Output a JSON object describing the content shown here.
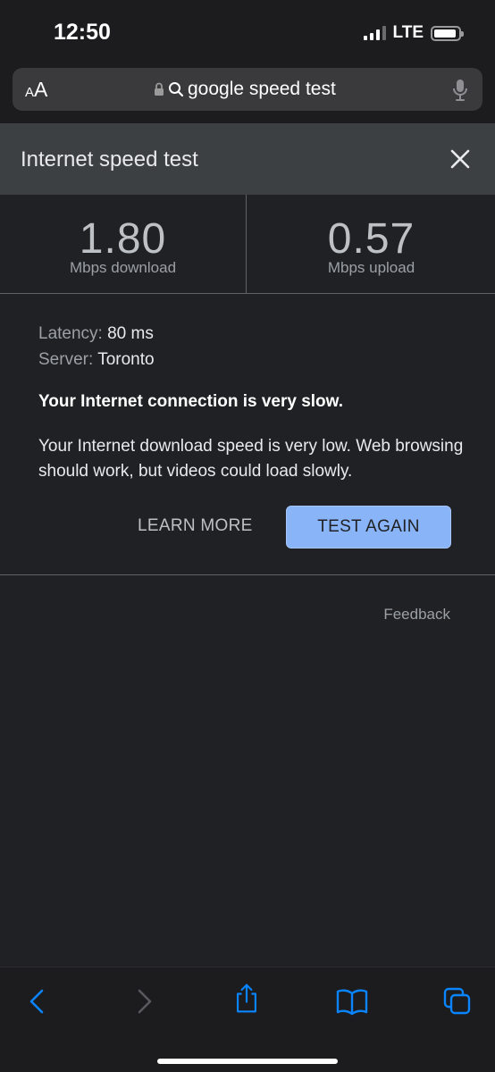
{
  "status_bar": {
    "time": "12:50",
    "network": "LTE"
  },
  "address_bar": {
    "aa_small": "A",
    "aa_large": "A",
    "url_text": "google speed test"
  },
  "card": {
    "title": "Internet speed test"
  },
  "results": {
    "download_value": "1.80",
    "download_label": "Mbps download",
    "upload_value": "0.57",
    "upload_label": "Mbps upload"
  },
  "details": {
    "latency_label": "Latency:",
    "latency_value": "80 ms",
    "server_label": "Server:",
    "server_value": "Toronto",
    "verdict": "Your Internet connection is very slow.",
    "explanation": "Your Internet download speed is very low. Web browsing should work, but videos could load slowly."
  },
  "actions": {
    "learn_more": "LEARN MORE",
    "test_again": "TEST AGAIN"
  },
  "feedback": "Feedback",
  "colors": {
    "accent": "#8ab4f8",
    "ios_blue": "#0a84ff",
    "background": "#202124",
    "header": "#3c4043"
  },
  "icons": [
    "signal-icon",
    "battery-icon",
    "lock-icon",
    "search-icon",
    "mic-icon",
    "close-icon",
    "back-icon",
    "forward-icon",
    "share-icon",
    "bookmarks-icon",
    "tabs-icon"
  ]
}
